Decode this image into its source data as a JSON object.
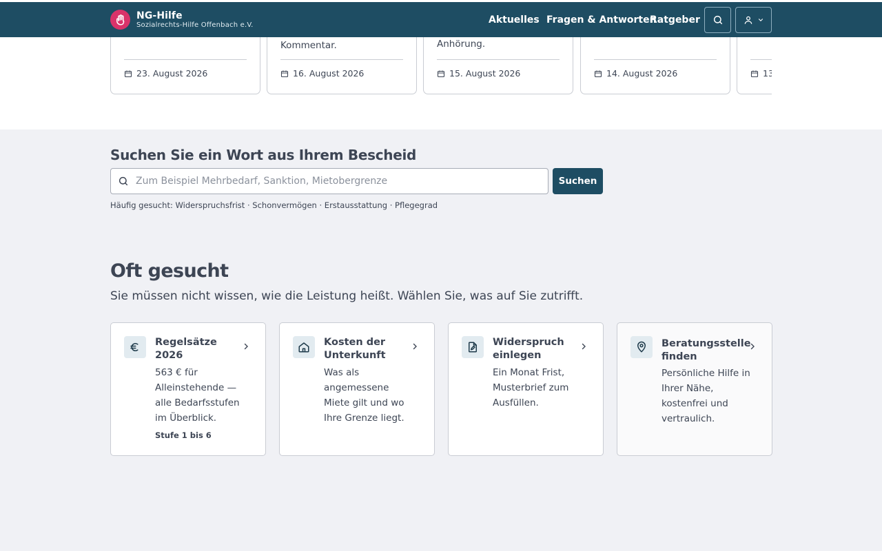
{
  "header": {
    "brand_name": "NG-Hilfe",
    "brand_sub": "Sozialrechts-Hilfe Offenbach e.V.",
    "nav": [
      "Aktuelles",
      "Fragen & Antworten",
      "Ratgeber"
    ],
    "accent": "#1e4d63",
    "logo_color": "#d9336a"
  },
  "news": [
    {
      "snippet": "",
      "date": "23. August 2026"
    },
    {
      "snippet": "Kommentar.",
      "date": "16. August 2026"
    },
    {
      "snippet": "Anhörung.",
      "date": "15. August 2026"
    },
    {
      "snippet": "",
      "date": "14. August 2026"
    },
    {
      "snippet": "",
      "date": "13"
    }
  ],
  "search": {
    "title": "Suchen Sie ein Wort aus Ihrem Bescheid",
    "placeholder": "Zum Beispiel Mehrbedarf, Sanktion, Mietobergrenze",
    "button": "Suchen",
    "frequent_prefix": "Häufig gesucht:",
    "frequent": [
      "Widerspruchsfrist",
      "Schonvermögen",
      "Erstausstattung",
      "Pflegegrad"
    ],
    "separator": " · "
  },
  "oft": {
    "title": "Oft gesucht",
    "subtitle": "Sie müssen nicht wissen, wie die Leistung heißt. Wählen Sie, was auf Sie zutrifft.",
    "tiles": [
      {
        "title": "Regelsätze 2026",
        "description": "563 € für Alleinstehende — alle Bedarfsstufen im Überblick.",
        "meta": "Stufe 1 bis 6",
        "icon": "euro-icon"
      },
      {
        "title": "Kosten der Unterkunft",
        "description": "Was als angemessene Miete gilt und wo Ihre Grenze liegt.",
        "meta": "",
        "icon": "home-icon"
      },
      {
        "title": "Widerspruch einlegen",
        "description": "Ein Monat Frist, Musterbrief zum Ausfüllen.",
        "meta": "",
        "icon": "document-edit-icon"
      },
      {
        "title": "Beratungsstelle finden",
        "description": "Persönliche Hilfe in Ihrer Nähe, kostenfrei und vertraulich.",
        "meta": "",
        "icon": "map-pin-icon"
      }
    ]
  }
}
